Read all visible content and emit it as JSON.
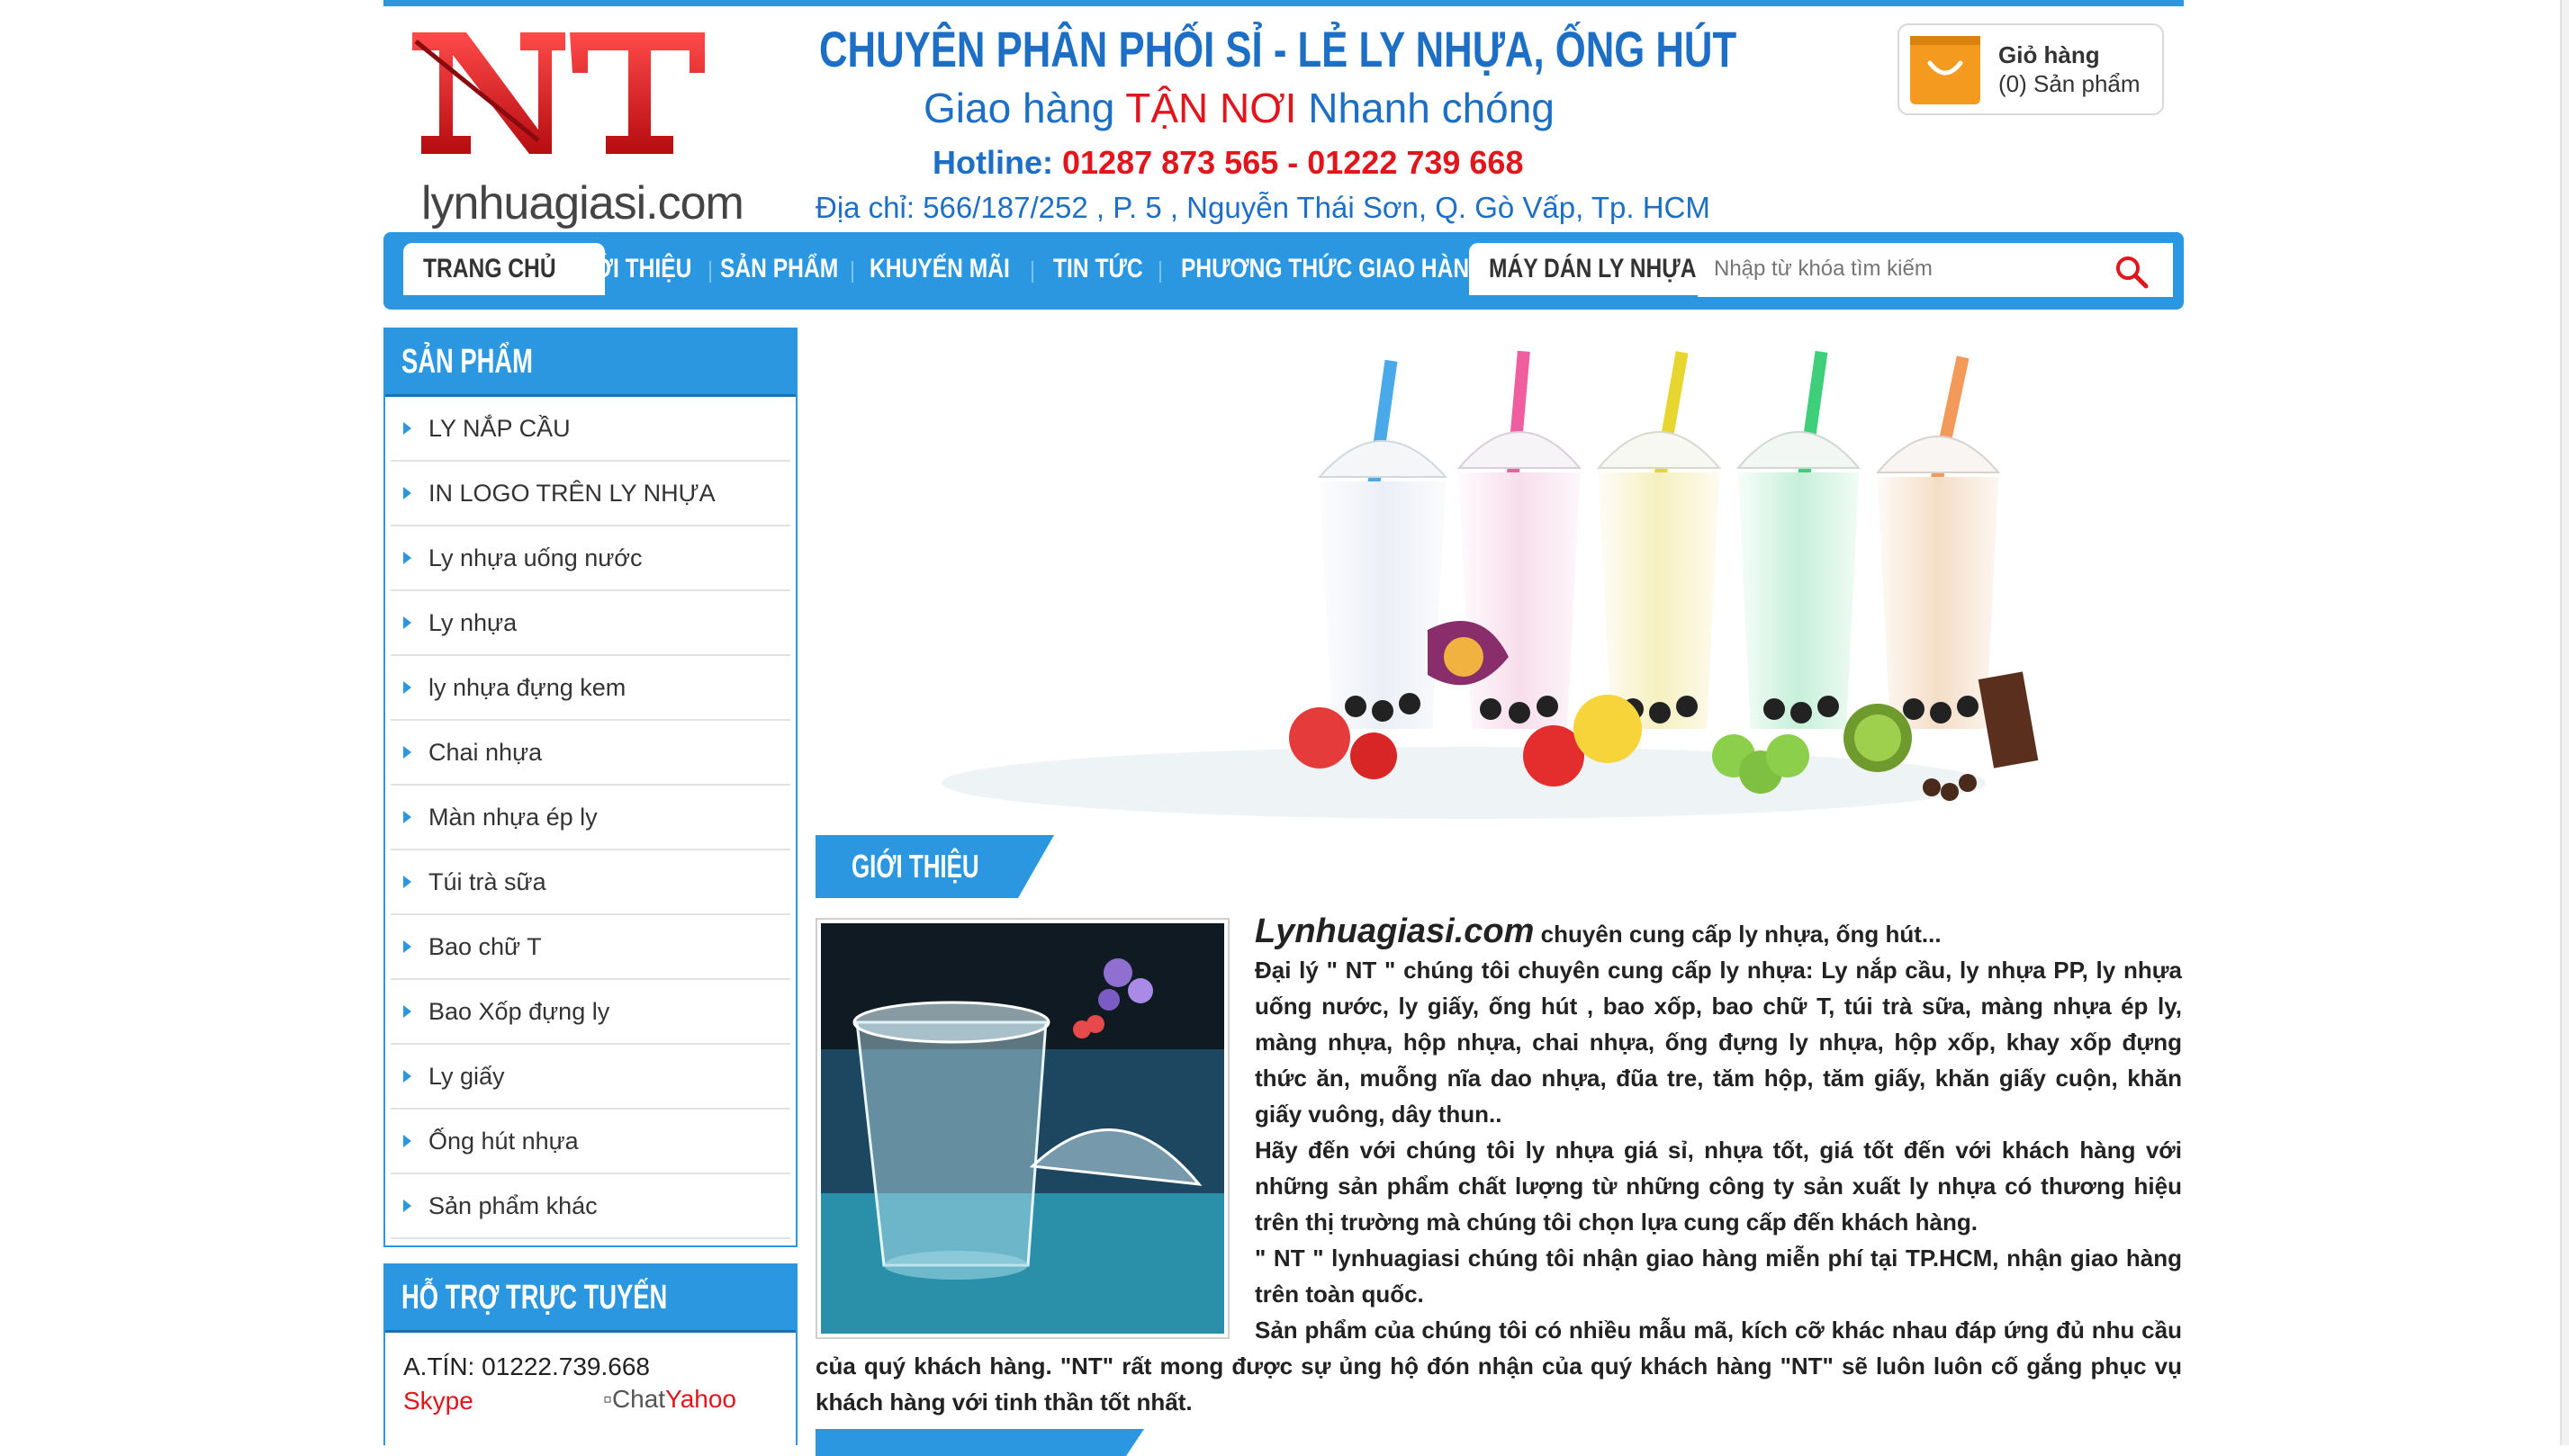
{
  "header": {
    "logo_letters": "NT",
    "logo_domain": "lynhuagiasi.com",
    "slogan_main": "CHUYÊN PHÂN PHỐI SỈ - LẺ LY NHỰA, ỐNG HÚT",
    "slogan_delivery_prefix": "Giao hàng",
    "slogan_delivery_highlight": "TẬN NƠI",
    "slogan_delivery_suffix": "Nhanh chóng",
    "hotline_label": "Hotline:",
    "hotline_numbers": "01287 873 565 - 01222 739 668",
    "address": "Địa chỉ: 566/187/252 , P. 5 , Nguyễn Thái Sơn, Q. Gò Vấp, Tp. HCM"
  },
  "cart": {
    "title": "Giỏ hàng",
    "count": "(0) Sản phẩm",
    "icon": "shopping-bag-icon",
    "color": "#f39a1f"
  },
  "nav": {
    "items": [
      {
        "label": "TRANG CHỦ",
        "active": true
      },
      {
        "label": "GIỚI THIỆU"
      },
      {
        "label": "SẢN PHẨM"
      },
      {
        "label": "KHUYẾN MÃI"
      },
      {
        "label": "TIN TỨC"
      },
      {
        "label": "PHƯƠNG THỨC GIAO HÀNG"
      },
      {
        "label": "MÁY DÁN LY NHỰA",
        "active": true
      }
    ],
    "search_placeholder": "Nhập từ khóa tìm kiếm",
    "search_icon": "search-icon",
    "color": "#2b97e0"
  },
  "sidebar": {
    "products_title": "SẢN PHẨM",
    "categories": [
      "LY NẮP CẦU",
      "IN LOGO TRÊN LY NHỰA",
      "Ly nhựa uống nước",
      "Ly nhựa",
      "ly nhựa đựng kem",
      "Chai nhựa",
      "Màn nhựa ép ly",
      "Túi trà sữa",
      "Bao chữ T",
      "Bao Xốp đựng ly",
      "Ly giấy",
      "Ống hút nhựa",
      "Sản phẩm khác"
    ],
    "support_title": "HỖ TRỢ TRỰC TUYẾN",
    "support_contact": "A.TÍN: 01222.739.668",
    "skype_label": "Skype",
    "yahoo_label_a": "Chat",
    "yahoo_label_b": "Yahoo"
  },
  "content": {
    "section_title": "GIỚI THIỆU",
    "brand": "Lynhuagiasi.com",
    "lead": " chuyên cung cấp ly nhựa, ống hút...",
    "paragraph1": "Đại lý \" NT \" chúng tôi chuyên cung cấp ly nhựa: Ly nắp cầu, ly nhựa PP, ly nhựa uống nước, ly giấy, ống hút , bao xốp, bao chữ T, túi trà sữa, màng nhựa ép ly, màng nhựa, hộp nhựa, chai nhựa, ống đựng ly nhựa, hộp xốp, khay xốp đựng thức ăn, muỗng nĩa dao nhựa, đũa tre, tăm hộp, tăm giấy, khăn giấy cuộn, khăn giấy vuông, dây thun..",
    "paragraph2": " Hãy đến với chúng tôi  ly nhựa giá sỉ, nhựa tốt, giá tốt đến với khách hàng với những sản phẩm chất lượng từ những công ty sản xuất ly nhựa có thương hiệu trên thị trường mà chúng tôi chọn lựa  cung cấp đến khách hàng.",
    "paragraph3": "\" NT \" lynhuagiasi chúng tôi nhận giao hàng miễn phí tại TP.HCM, nhận giao hàng trên toàn quốc.",
    "paragraph4": " Sản phẩm của chúng tôi có nhiều mẫu mã, kích cỡ khác nhau đáp ứng đủ nhu cầu của quý khách hàng. \"NT\" rất mong được sự ủng hộ đón nhận của quý khách hàng \"NT\" sẽ luôn luôn cố gắng phục vụ khách hàng với tinh thần tốt nhất."
  },
  "colors": {
    "primary_blue": "#2b97e0",
    "logo_red": "#e0161c",
    "text_blue": "#1d6fc5"
  }
}
